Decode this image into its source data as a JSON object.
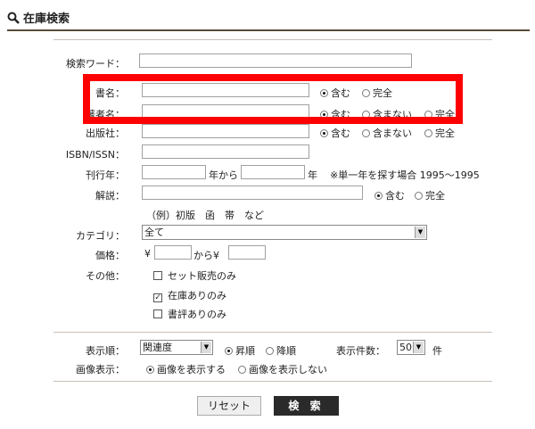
{
  "header": {
    "title": "在庫検索"
  },
  "form": {
    "keyword": {
      "label": "検索ワード：",
      "value": ""
    },
    "title": {
      "label": "書名：",
      "value": "",
      "options": [
        "含む",
        "完全"
      ],
      "selected": "含む"
    },
    "author": {
      "label": "著者名：",
      "value": "",
      "options": [
        "含む",
        "含まない",
        "完全"
      ],
      "selected": "含む"
    },
    "publisher": {
      "label": "出版社：",
      "value": "",
      "options": [
        "含む",
        "含まない",
        "完全"
      ]
    },
    "isbn": {
      "label": "ISBN/ISSN：",
      "value": ""
    },
    "year": {
      "label": "刊行年：",
      "from_suffix": "年から",
      "to_suffix": "年",
      "note": "※単一年を探す場合 1995～1995"
    },
    "description": {
      "label": "解説：",
      "value": "",
      "options": [
        "含む",
        "完全"
      ],
      "selected": "含む",
      "example": "（例）初版　函　帯　など"
    },
    "category": {
      "label": "カテゴリ：",
      "value": "全て"
    },
    "price": {
      "label": "価格：",
      "currency": "¥",
      "middle": "から¥"
    },
    "other": {
      "label": "その他：",
      "items": [
        {
          "label": "セット販売のみ",
          "checked": false
        },
        {
          "label": "在庫ありのみ",
          "checked": true
        },
        {
          "label": "書評ありのみ",
          "checked": false
        }
      ]
    }
  },
  "display": {
    "order_label": "表示順：",
    "order_value": "関連度",
    "asc": "昇順",
    "desc": "降順",
    "count_label": "表示件数：",
    "count_value": "50",
    "count_unit": "件",
    "image_label": "画像表示：",
    "image_on": "画像を表示する",
    "image_off": "画像を表示しない"
  },
  "buttons": {
    "reset": "リセット",
    "search": "検 索"
  },
  "colors": {
    "highlight": "#ff0000",
    "search_button": "#2a2a2a",
    "title_rule": "#5a4a3a"
  }
}
